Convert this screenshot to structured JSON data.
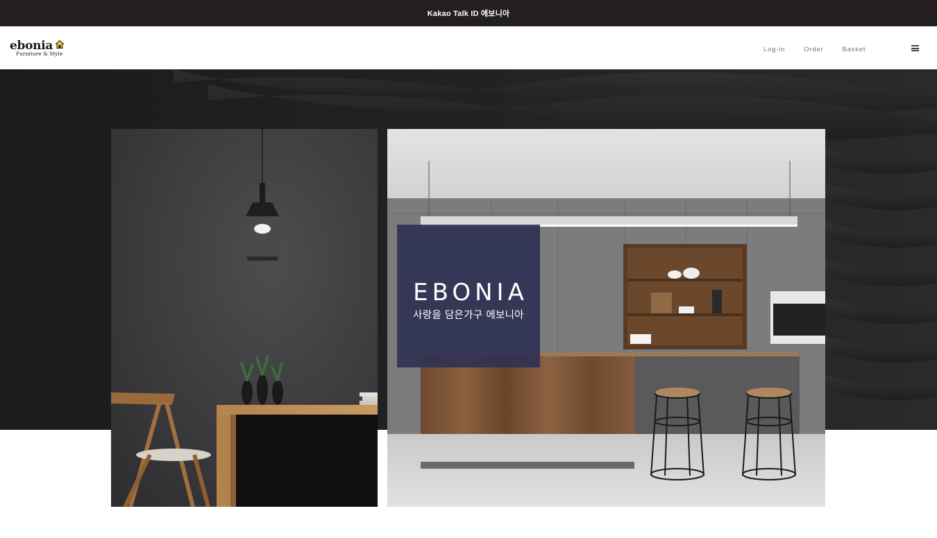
{
  "announcement": {
    "text": "Kakao Talk ID 에보니아"
  },
  "logo": {
    "wordmark": "ebonia",
    "tagline": "Furniture & Style",
    "house_icon": "house-icon",
    "house_color": "#f2c12e"
  },
  "nav": {
    "items": [
      {
        "label": "Log-in"
      },
      {
        "label": "Order"
      },
      {
        "label": "Basket"
      }
    ],
    "menu_icon": "hamburger-menu-icon"
  },
  "hero": {
    "brand_title": "EBONIA",
    "brand_subtitle": "사랑을 담은가구 에보니아",
    "box_color": "#2f3154"
  },
  "colors": {
    "topbar_bg": "#231f20",
    "hero_bg": "#1d1d1f"
  }
}
